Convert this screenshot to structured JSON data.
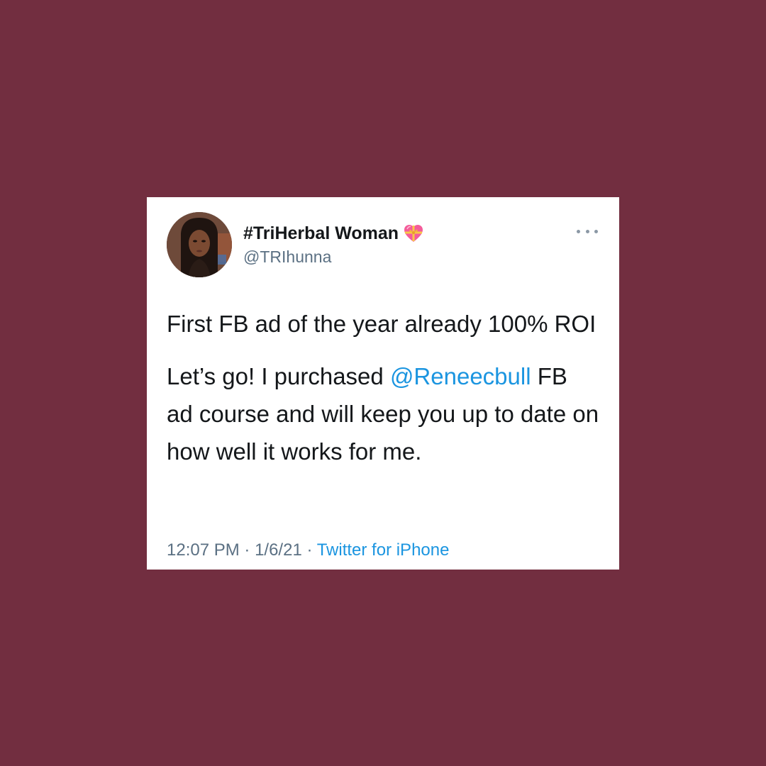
{
  "tweet": {
    "author": {
      "display_name": "#TriHerbal Woman",
      "handle": "@TRIhunna",
      "badge_icon": "heart-with-ribbon-icon"
    },
    "more_icon": "more-options-icon",
    "body": {
      "paragraph1": "First FB ad of the year already 100% ROI",
      "paragraph2_before": "Let’s go! I purchased ",
      "mention": "@Reneecbull",
      "paragraph2_after": " FB ad course and will keep you up to date on how well it works for me."
    },
    "meta": {
      "time": "12:07 PM",
      "separator1": " · ",
      "date": "1/6/21",
      "separator2": " · ",
      "source": "Twitter for iPhone"
    }
  },
  "colors": {
    "page_background": "#722e40",
    "card_background": "#ffffff",
    "text_primary": "#14171a",
    "text_secondary": "#5b7083",
    "link": "#1b95e0"
  }
}
